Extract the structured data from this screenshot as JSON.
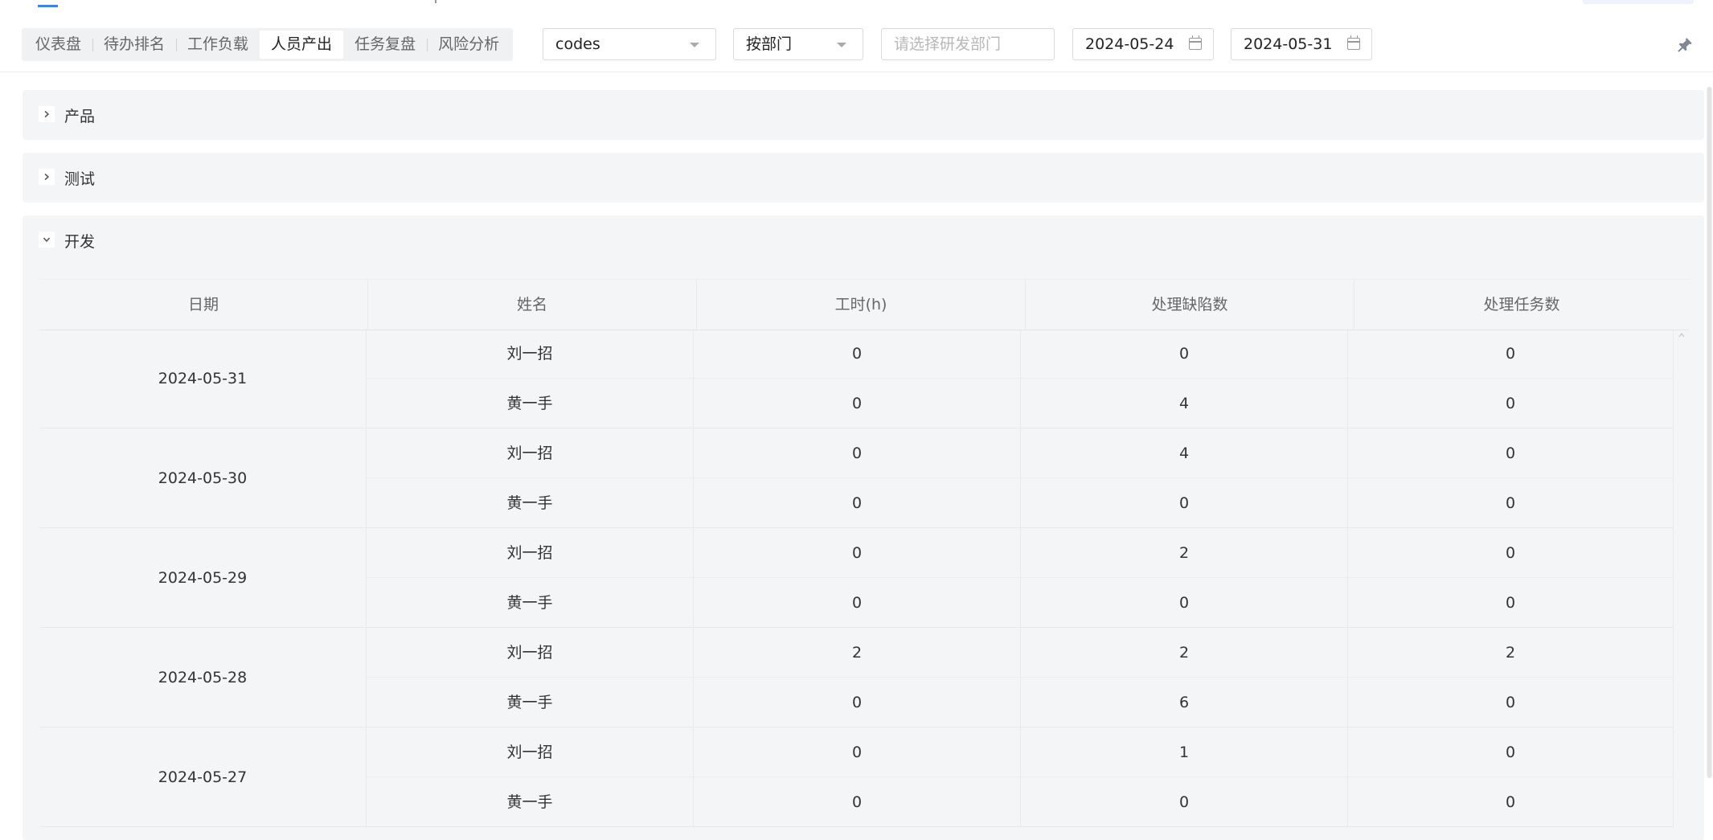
{
  "toolbar": {
    "tabs": [
      {
        "label": "仪表盘"
      },
      {
        "label": "待办排名"
      },
      {
        "label": "工作负载"
      },
      {
        "label": "人员产出"
      },
      {
        "label": "任务复盘"
      },
      {
        "label": "风险分析"
      }
    ],
    "active_tab": "人员产出",
    "project_select": {
      "value": "codes"
    },
    "group_select": {
      "value": "按部门"
    },
    "dept_select": {
      "placeholder": "请选择研发部门"
    },
    "start_date": {
      "value": "2024-05-24"
    },
    "end_date": {
      "value": "2024-05-31"
    },
    "icons": {
      "pin": "pin-icon",
      "calendar": "calendar-icon",
      "dropdown": "chevron-down-icon"
    }
  },
  "sections": [
    {
      "title": "产品",
      "expanded": false
    },
    {
      "title": "测试",
      "expanded": false
    },
    {
      "title": "开发",
      "expanded": true
    }
  ],
  "table": {
    "columns": [
      "日期",
      "姓名",
      "工时(h)",
      "处理缺陷数",
      "处理任务数"
    ],
    "groups": [
      {
        "date": "2024-05-31",
        "rows": [
          {
            "name": "刘一招",
            "hours": "0",
            "defects": "0",
            "tasks": "0"
          },
          {
            "name": "黄一手",
            "hours": "0",
            "defects": "4",
            "tasks": "0"
          }
        ]
      },
      {
        "date": "2024-05-30",
        "rows": [
          {
            "name": "刘一招",
            "hours": "0",
            "defects": "4",
            "tasks": "0"
          },
          {
            "name": "黄一手",
            "hours": "0",
            "defects": "0",
            "tasks": "0"
          }
        ]
      },
      {
        "date": "2024-05-29",
        "rows": [
          {
            "name": "刘一招",
            "hours": "0",
            "defects": "2",
            "tasks": "0"
          },
          {
            "name": "黄一手",
            "hours": "0",
            "defects": "0",
            "tasks": "0"
          }
        ]
      },
      {
        "date": "2024-05-28",
        "rows": [
          {
            "name": "刘一招",
            "hours": "2",
            "defects": "2",
            "tasks": "2"
          },
          {
            "name": "黄一手",
            "hours": "0",
            "defects": "6",
            "tasks": "0"
          }
        ]
      },
      {
        "date": "2024-05-27",
        "rows": [
          {
            "name": "刘一招",
            "hours": "0",
            "defects": "1",
            "tasks": "0"
          },
          {
            "name": "黄一手",
            "hours": "0",
            "defects": "0",
            "tasks": "0"
          }
        ]
      }
    ]
  },
  "colors": {
    "accent": "#3b82f6",
    "section_bg": "#f4f5f7",
    "tab_bg": "#f0f1f3"
  }
}
